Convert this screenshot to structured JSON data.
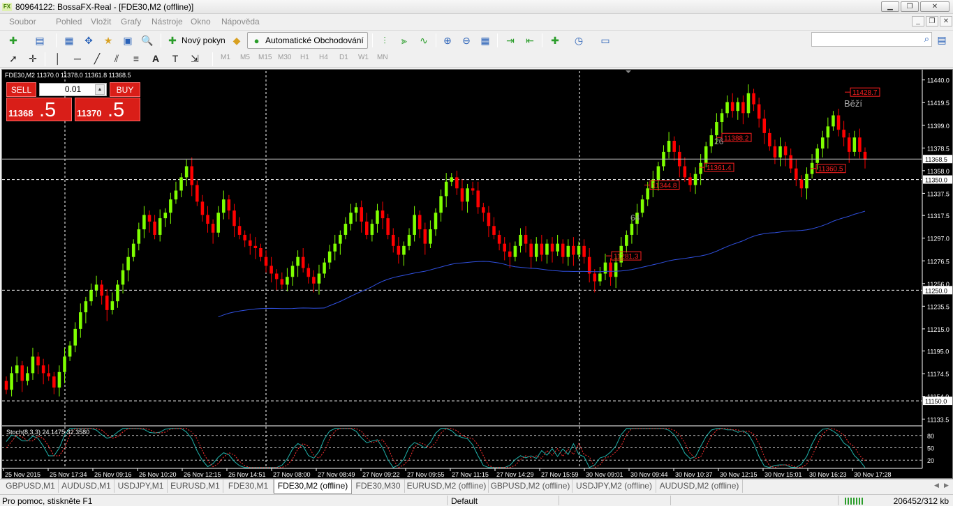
{
  "window": {
    "title": "80964122: BossaFX-Real - [FDE30,M2 (offline)]",
    "icon_text": "FX"
  },
  "menu": [
    "Soubor",
    "Pohled",
    "Vložit",
    "Grafy",
    "Nástroje",
    "Okno",
    "Nápověda"
  ],
  "toolbar": {
    "new_order_label": "Nový pokyn",
    "auto_trading_label": "Automatické Obchodování",
    "search_placeholder": ""
  },
  "timeframes": [
    "M1",
    "M5",
    "M15",
    "M30",
    "H1",
    "H4",
    "D1",
    "W1",
    "MN"
  ],
  "oneclick": {
    "sell_label": "SELL",
    "buy_label": "BUY",
    "lot": "0.01",
    "bid_small": "11368",
    "bid_big": ".5",
    "ask_small": "11370",
    "ask_big": ".5"
  },
  "chart_data": {
    "type": "candlestick",
    "symbol_header": "FDE30,M2  11370.0 11378.0 11361.8 11368.5",
    "current_price": "11368.5",
    "ylim": [
      11128,
      11448
    ],
    "y_ticks": [
      "11440.0",
      "11419.5",
      "11399.0",
      "11378.5",
      "11358.0",
      "11337.5",
      "11317.5",
      "11297.0",
      "11276.5",
      "11256.0",
      "11235.5",
      "11215.0",
      "11195.0",
      "11174.5",
      "11154.0",
      "11133.5"
    ],
    "hlines": [
      "11350.0",
      "11250.0",
      "11150.0"
    ],
    "x_ticks": [
      "25 Nov 2015",
      "25 Nov 17:34",
      "26 Nov 09:16",
      "26 Nov 10:20",
      "26 Nov 12:15",
      "26 Nov 14:51",
      "27 Nov 08:00",
      "27 Nov 08:49",
      "27 Nov 09:22",
      "27 Nov 09:55",
      "27 Nov 11:15",
      "27 Nov 14:29",
      "27 Nov 15:59",
      "30 Nov 09:01",
      "30 Nov 09:44",
      "30 Nov 10:37",
      "30 Nov 12:15",
      "30 Nov 15:01",
      "30 Nov 16:23",
      "30 Nov 17:28"
    ],
    "closes": [
      11160,
      11175,
      11182,
      11168,
      11175,
      11190,
      11182,
      11175,
      11172,
      11162,
      11176,
      11190,
      11200,
      11215,
      11230,
      11240,
      11250,
      11255,
      11245,
      11232,
      11240,
      11255,
      11268,
      11280,
      11292,
      11305,
      11318,
      11312,
      11300,
      11315,
      11320,
      11332,
      11340,
      11352,
      11362,
      11345,
      11330,
      11318,
      11310,
      11302,
      11320,
      11332,
      11322,
      11308,
      11300,
      11295,
      11290,
      11288,
      11280,
      11272,
      11265,
      11260,
      11255,
      11262,
      11272,
      11280,
      11270,
      11262,
      11256,
      11265,
      11275,
      11285,
      11292,
      11300,
      11310,
      11320,
      11325,
      11312,
      11300,
      11310,
      11322,
      11315,
      11300,
      11290,
      11282,
      11290,
      11300,
      11318,
      11305,
      11292,
      11305,
      11320,
      11335,
      11348,
      11352,
      11342,
      11330,
      11342,
      11340,
      11325,
      11320,
      11308,
      11300,
      11292,
      11285,
      11280,
      11290,
      11300,
      11292,
      11280,
      11292,
      11282,
      11292,
      11285,
      11292,
      11280,
      11290,
      11282,
      11290,
      11280,
      11265,
      11258,
      11265,
      11275,
      11262,
      11275,
      11290,
      11300,
      11310,
      11320,
      11332,
      11342,
      11350,
      11362,
      11375,
      11385,
      11375,
      11362,
      11352,
      11345,
      11355,
      11365,
      11380,
      11390,
      11402,
      11410,
      11420,
      11412,
      11420,
      11410,
      11428,
      11418,
      11405,
      11392,
      11380,
      11370,
      11380,
      11372,
      11360,
      11350,
      11342,
      11355,
      11365,
      11378,
      11388,
      11398,
      11408,
      11395,
      11388,
      11375,
      11388,
      11375,
      11368
    ],
    "ma_label": "",
    "annotations": [
      {
        "text": "11428.7"
      },
      {
        "text": "11388.2"
      },
      {
        "text": "11361.4"
      },
      {
        "text": "11360.5"
      },
      {
        "text": "11344.8"
      },
      {
        "text": "11281.3"
      }
    ],
    "marks": [
      "26",
      "64"
    ],
    "status_text": "Běží",
    "indicator": {
      "label": "Stoch(8,3,3) 24.1475 32.3580",
      "levels": [
        "80",
        "50",
        "20"
      ]
    }
  },
  "tabs": [
    "GBPUSD,M1",
    "AUDUSD,M1",
    "USDJPY,M1",
    "EURUSD,M1",
    "FDE30,M1",
    "FDE30,M2 (offline)",
    "FDE30,M30",
    "EURUSD,M2 (offline)",
    "GBPUSD,M2 (offline)",
    "USDJPY,M2 (offline)",
    "AUDUSD,M2 (offline)"
  ],
  "active_tab": "FDE30,M2 (offline)",
  "status": {
    "help": "Pro pomoc, stiskněte F1",
    "profile": "Default",
    "traffic": "206452/312 kb"
  },
  "colors": {
    "bull": "#7fff00",
    "bear": "#ff0000",
    "ma": "#3050e0",
    "grid": "#ffffff",
    "sell_buy": "#d91e18"
  }
}
